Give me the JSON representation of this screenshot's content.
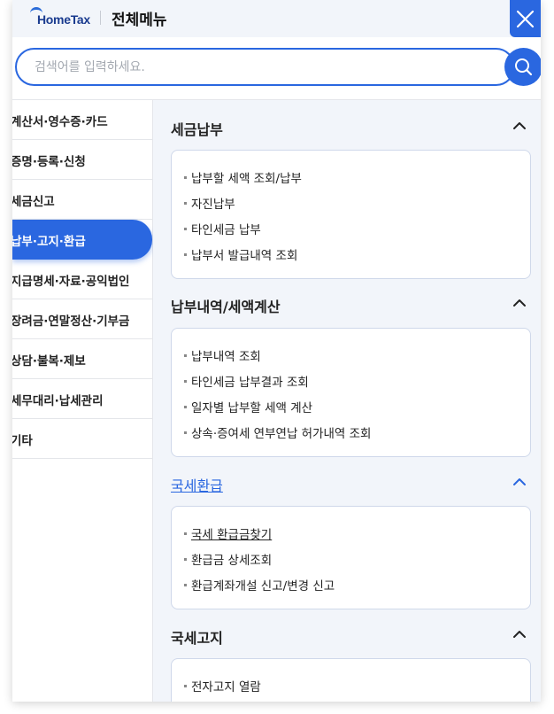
{
  "header": {
    "logo_brand": "HomeTax",
    "title": "전체메뉴"
  },
  "search": {
    "placeholder": "검색어를 입력하세요."
  },
  "sidebar": {
    "items": [
      {
        "label": "계산서·영수증·카드"
      },
      {
        "label": "증명·등록·신청"
      },
      {
        "label": "세금신고"
      },
      {
        "label": "납부·고지·환급"
      },
      {
        "label": "지급명세·자료·공익법인"
      },
      {
        "label": "장려금·연말정산·기부금"
      },
      {
        "label": "상담·불복·제보"
      },
      {
        "label": "세무대리·납세관리"
      },
      {
        "label": "기타"
      }
    ],
    "active_index": 3
  },
  "sections": [
    {
      "title": "세금납부",
      "links": [
        "납부할 세액 조회/납부",
        "자진납부",
        "타인세금 납부",
        "납부서 발급내역 조회"
      ]
    },
    {
      "title": "납부내역/세액계산",
      "links": [
        "납부내역 조회",
        "타인세금 납부결과 조회",
        "일자별 납부할 세액 계산",
        "상속·증여세 연부연납 허가내역 조회"
      ]
    },
    {
      "title": "국세환급",
      "links": [
        "국세 환급금찾기",
        "환급금 상세조회",
        "환급계좌개설 신고/변경 신고"
      ]
    },
    {
      "title": "국세고지",
      "links": [
        "전자고지 열람"
      ]
    }
  ],
  "colors": {
    "accent": "#2a67e0",
    "panel_bg": "#f2f5fa"
  }
}
